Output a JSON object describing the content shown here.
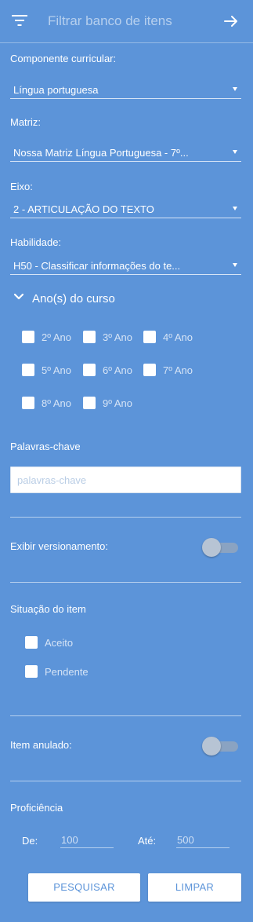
{
  "header": {
    "title": "Filtrar banco de itens",
    "filter_icon": "filter-list-icon",
    "close_icon": "arrow-right-icon"
  },
  "componente": {
    "label": "Componente curricular:",
    "value": "Língua portuguesa"
  },
  "matriz": {
    "label": "Matriz:",
    "value": "Nossa Matriz Língua Portuguesa - 7º..."
  },
  "eixo": {
    "label": "Eixo:",
    "value": "2 - ARTICULAÇÃO DO TEXTO"
  },
  "habilidade": {
    "label": "Habilidade:",
    "value": "H50 - Classificar informações do te..."
  },
  "anos": {
    "label": "Ano(s) do curso",
    "options": [
      "2º Ano",
      "3º Ano",
      "4º Ano",
      "5º Ano",
      "6º Ano",
      "7º Ano",
      "8º Ano",
      "9º Ano"
    ]
  },
  "palavras_chave": {
    "label": "Palavras-chave",
    "placeholder": "palavras-chave"
  },
  "versionamento": {
    "label": "Exibir versionamento:",
    "enabled": false
  },
  "situacao": {
    "label": "Situação do item",
    "options": [
      "Aceito",
      "Pendente"
    ]
  },
  "anulado": {
    "label": "Item anulado:",
    "enabled": false
  },
  "proficiencia": {
    "label": "Proficiência",
    "de_label": "De:",
    "de_value": "100",
    "ate_label": "Até:",
    "ate_value": "500"
  },
  "actions": {
    "search": "PESQUISAR",
    "clear": "LIMPAR"
  },
  "colors": {
    "background": "#5c94d9",
    "button_text": "#5c94d9"
  }
}
